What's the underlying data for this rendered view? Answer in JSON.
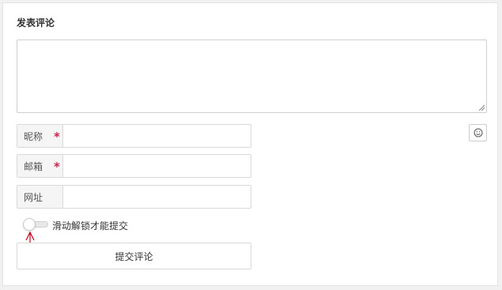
{
  "form": {
    "title": "发表评论",
    "comment_value": "",
    "fields": [
      {
        "label": "昵称",
        "required": true,
        "value": ""
      },
      {
        "label": "邮箱",
        "required": true,
        "value": ""
      },
      {
        "label": "网址",
        "required": false,
        "value": ""
      }
    ],
    "required_mark": "*",
    "emoji_icon": "smiley-icon",
    "slider_label": "滑动解锁才能提交",
    "slider_unlocked": false,
    "submit_label": "提交评论"
  },
  "colors": {
    "required_star": "#c7254e",
    "annotation_arrow": "#c0001a"
  }
}
